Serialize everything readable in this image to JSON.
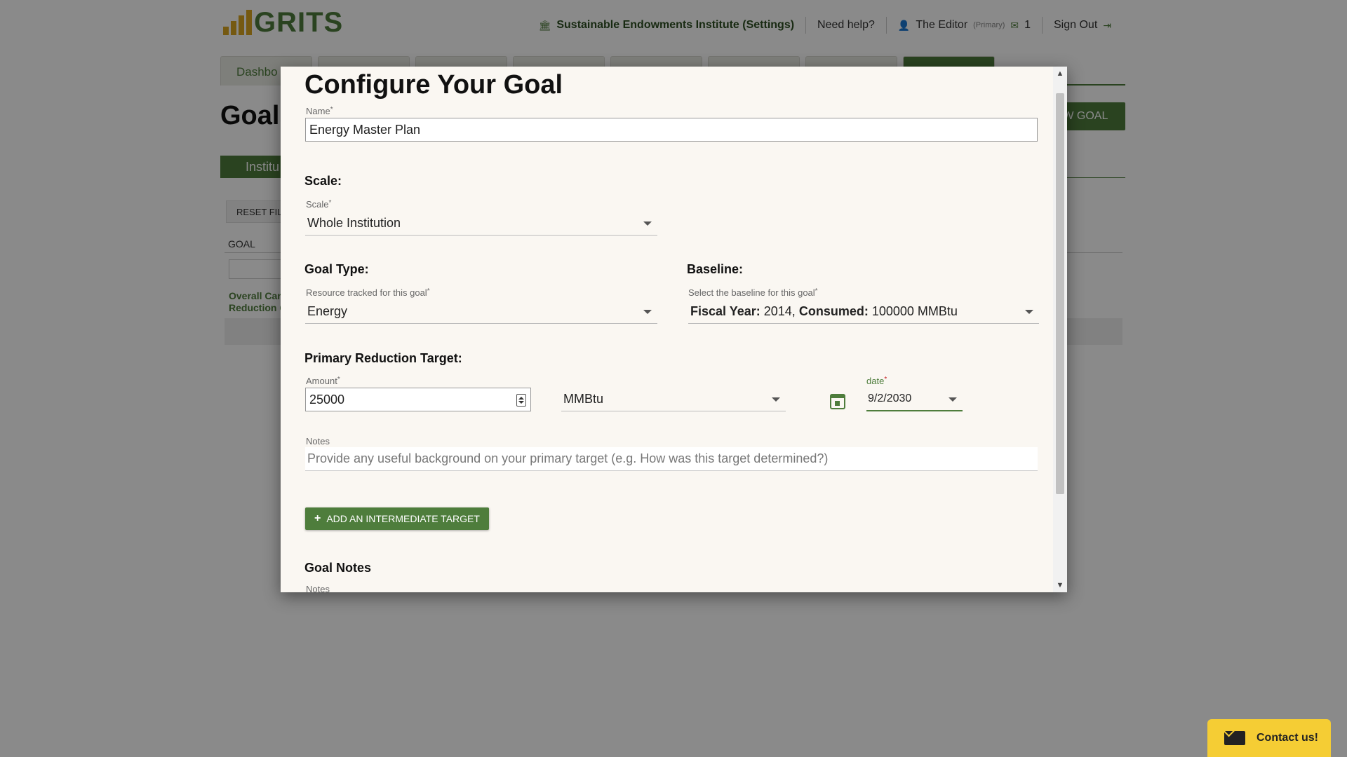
{
  "app": {
    "logo_text": "GRITS",
    "colors": {
      "brand_green": "#4e7d3c",
      "logo_gold": "#d9a520",
      "contact_yellow": "#f5cd34",
      "modal_bg": "#faf7f2"
    }
  },
  "top_nav": {
    "org_label": "Sustainable Endowments Institute (Settings)",
    "help_label": "Need help?",
    "user_name": "The Editor",
    "user_role": "(Primary)",
    "message_count": "1",
    "sign_out_label": "Sign Out",
    "icons": [
      "institution-icon",
      "user-icon",
      "mail-icon",
      "sign-out-icon"
    ]
  },
  "main_tabs": [
    {
      "label": "Dashbo"
    },
    {
      "label": ""
    },
    {
      "label": ""
    },
    {
      "label": ""
    },
    {
      "label": ""
    },
    {
      "label": ""
    },
    {
      "label": ""
    },
    {
      "label": ""
    }
  ],
  "page": {
    "heading": "Goals",
    "new_goal_label": "EW GOAL",
    "sub_tab_label": "Institu",
    "reset_label": "RESET FILT",
    "goal_column": "GOAL",
    "goal_link": "Overall Car Reduction G"
  },
  "modal": {
    "title": "Configure Your Goal",
    "name": {
      "label": "Name",
      "value": "Energy Master Plan"
    },
    "scale_section": "Scale:",
    "scale": {
      "label": "Scale",
      "value": "Whole Institution"
    },
    "goal_type_section": "Goal Type:",
    "resource": {
      "label": "Resource tracked for this goal",
      "value": "Energy"
    },
    "baseline_section": "Baseline:",
    "baseline": {
      "label": "Select the baseline for this goal",
      "fy_label": "Fiscal Year:",
      "fy_value": "2014,",
      "consumed_label": "Consumed:",
      "consumed_value": "100000 MMBtu"
    },
    "primary_section": "Primary Reduction Target:",
    "amount": {
      "label": "Amount",
      "value": "25000"
    },
    "unit": {
      "value": "MMBtu"
    },
    "date": {
      "label": "date",
      "value": "9/2/2030"
    },
    "target_notes": {
      "label": "Notes",
      "placeholder": "Provide any useful background on your primary target (e.g. How was this target determined?)"
    },
    "add_intermediate_label": "ADD AN INTERMEDIATE TARGET",
    "goal_notes_section": "Goal Notes",
    "goal_notes_label": "Notes"
  },
  "contact": {
    "label": "Contact us!"
  }
}
